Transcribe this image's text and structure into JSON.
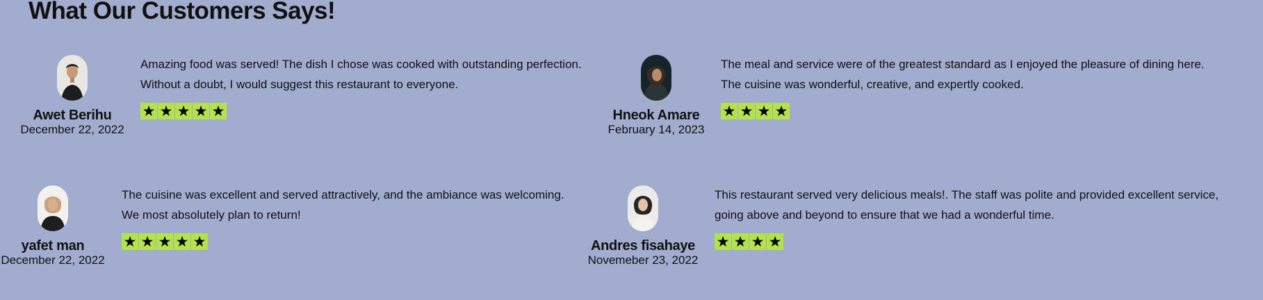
{
  "section": {
    "title": "What Our Customers Says!"
  },
  "reviews": [
    {
      "name": "Awet Berihu",
      "date": "December 22, 2022",
      "lines": [
        "Amazing food was served! The dish I chose was cooked with outstanding perfection.",
        "Without a doubt, I would suggest this restaurant to everyone."
      ],
      "rating": 5,
      "star_glyph": "★",
      "avatar_icon": "man-portrait-icon"
    },
    {
      "name": "Hneok Amare",
      "date": "February 14, 2023",
      "lines": [
        "The meal and service were of the greatest standard as I enjoyed the pleasure of dining here.",
        "The cuisine was wonderful, creative, and expertly cooked."
      ],
      "rating": 4,
      "star_glyph": "★",
      "avatar_icon": "woman-portrait-icon"
    },
    {
      "name": "yafet man",
      "date": "December 22, 2022",
      "lines": [
        "The cuisine was excellent and served attractively, and the ambiance was welcoming.",
        "We most absolutely plan to return!"
      ],
      "rating": 5,
      "star_glyph": "★",
      "avatar_icon": "woman-portrait-icon"
    },
    {
      "name": "Andres fisahaye",
      "date": "Novemeber 23, 2022",
      "lines": [
        "This restaurant served very delicious meals!. The staff was polite and provided excellent service,",
        "going above and beyond to ensure that we had a wonderful time."
      ],
      "rating": 4,
      "star_glyph": "★",
      "avatar_icon": "woman-portrait-icon"
    }
  ],
  "colors": {
    "background": "#a1acce",
    "star_background": "#b4e24a",
    "text": "#111111"
  }
}
